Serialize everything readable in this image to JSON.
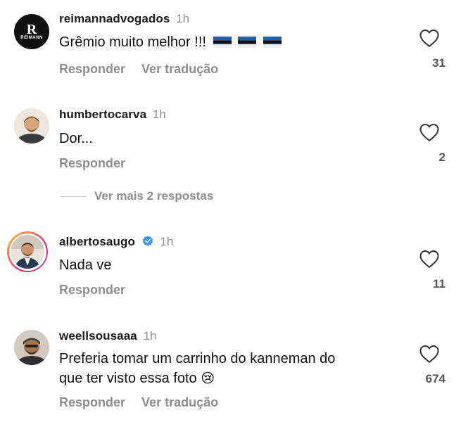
{
  "comments": [
    {
      "username": "reimannadvogados",
      "time": "1h",
      "text": "Grêmio muito melhor !!!",
      "actions": [
        "Responder",
        "Ver tradução"
      ],
      "likes": "31",
      "avatar_text": "REIMANN",
      "avatar_letter": "R"
    },
    {
      "username": "humbertocarva",
      "time": "1h",
      "text": "Dor...",
      "actions": [
        "Responder"
      ],
      "likes": "2"
    },
    {
      "username": "albertosaugo",
      "time": "1h",
      "text": "Nada ve",
      "actions": [
        "Responder"
      ],
      "likes": "11",
      "verified": true
    },
    {
      "username": "weellsousaaa",
      "time": "1h",
      "text_line1": "Preferia tomar um carrinho do kanneman do",
      "text_line2": "que ter visto essa foto",
      "emoji": "😢",
      "actions": [
        "Responder",
        "Ver tradução"
      ],
      "likes": "674"
    }
  ],
  "more_replies": "Ver mais 2 respostas",
  "colors": {
    "muted": "#8e8e8e",
    "verified": "#3897f0",
    "flag_blue": "#1f5fb5",
    "story_ring_start": "#f9ce34",
    "story_ring_end": "#ee2a7b"
  }
}
